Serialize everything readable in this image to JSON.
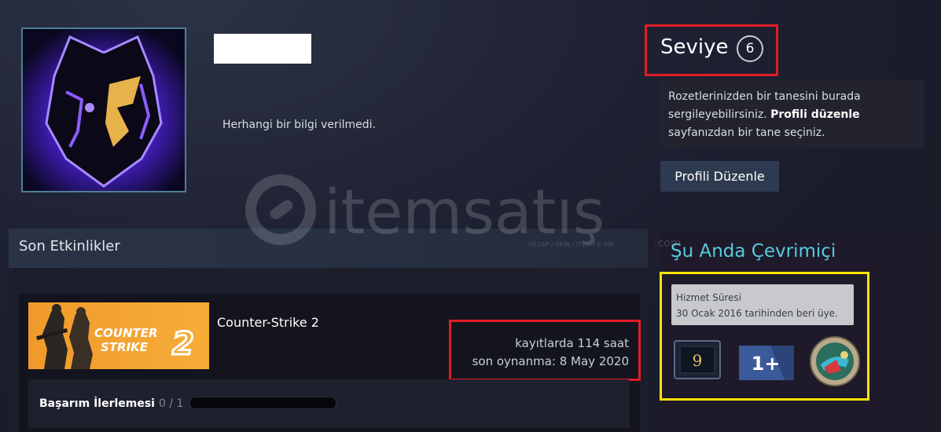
{
  "profile": {
    "summary": "Herhangi bir bilgi verilmedi."
  },
  "level": {
    "label": "Seviye",
    "value": "6"
  },
  "badge_info": {
    "text_before": "Rozetlerinizden bir tanesini burada sergileyebilirsiniz. ",
    "link_text": "Profili düzenle",
    "text_after": " sayfanızdan bir tane seçiniz."
  },
  "edit_profile_button": "Profili Düzenle",
  "watermark": {
    "brand": "itemsatış",
    "tld": ".com",
    "tagline": "HESAP / SKIN / ITEM / E-PIN"
  },
  "recent_activity": {
    "title": "Son Etkinlikler",
    "game": {
      "image_title_line1": "COUNTER",
      "image_title_line2": "STRIKE",
      "image_title_number": "2",
      "name": "Counter-Strike 2",
      "hours": "kayıtlarda 114 saat",
      "last_played": "son oynanma: 8 May 2020",
      "achievement_label": "Başarım İlerlemesi",
      "achievement_count": "0 / 1",
      "achievement_progress": 0
    }
  },
  "online": {
    "status": "Şu Anda Çevrimiçi",
    "service_title": "Hizmet Süresi",
    "service_text": "30 Ocak 2016 tarihinden beri üye.",
    "badges": [
      {
        "icon": "years-of-service-badge-icon",
        "label": "9"
      },
      {
        "icon": "one-plus-badge-icon",
        "label": "1+"
      },
      {
        "icon": "game-badge-icon"
      }
    ]
  },
  "colors": {
    "highlight_red": "#e21b25",
    "highlight_yellow": "#ffe400",
    "online_blue": "#57cbde"
  }
}
